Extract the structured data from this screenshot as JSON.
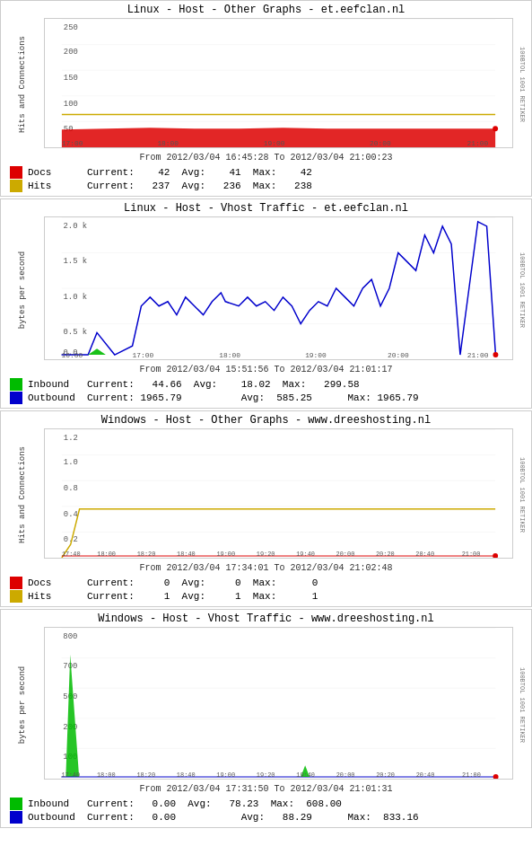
{
  "charts": [
    {
      "id": "linux-host-other",
      "title": "Linux - Host - Other Graphs - et.eefclan.nl",
      "timestamp_from": "From 2012/03/04 16:45:28 To 2012/03/04 21:00:23",
      "y_axis_label": "Hits and Connections",
      "right_label": "100BTOL  1001  RETIKER",
      "x_labels": [
        "17:00",
        "18:00",
        "19:00",
        "20:00",
        "21:00"
      ],
      "y_max": 250,
      "legend": [
        {
          "color": "#dd0000",
          "label": "Docs",
          "current": "42",
          "avg": "41",
          "max": "42"
        },
        {
          "color": "#ccaa00",
          "label": "Hits",
          "current": "237",
          "avg": "236",
          "max": "238"
        }
      ],
      "type": "hits"
    },
    {
      "id": "linux-host-vhost",
      "title": "Linux - Host - Vhost Traffic - et.eefclan.nl",
      "timestamp_from": "From 2012/03/04 15:51:56 To 2012/03/04 21:01:17",
      "y_axis_label": "bytes per second",
      "right_label": "100BTOL  1001  RETIKER",
      "x_labels": [
        "16:00",
        "17:00",
        "18:00",
        "19:00",
        "20:00",
        "21:00"
      ],
      "y_max": 2000,
      "legend": [
        {
          "color": "#00bb00",
          "label": "Inbound",
          "current": "44.66",
          "avg": "18.02",
          "max": "299.58"
        },
        {
          "color": "#0000cc",
          "label": "Outbound",
          "current": "1965.79",
          "avg": "585.25",
          "max": "1965.79"
        }
      ],
      "type": "traffic"
    },
    {
      "id": "windows-host-other",
      "title": "Windows - Host - Other Graphs - www.dreeshosting.nl",
      "timestamp_from": "From 2012/03/04 17:34:01 To 2012/03/04 21:02:48",
      "y_axis_label": "Hits and Connections",
      "right_label": "100BTOL  1001  RETIKER",
      "x_labels": [
        "17:40",
        "18:00",
        "18:20",
        "18:40",
        "19:00",
        "19:20",
        "19:40",
        "20:00",
        "20:20",
        "20:40",
        "21:00"
      ],
      "y_max": 1.4,
      "legend": [
        {
          "color": "#dd0000",
          "label": "Docs",
          "current": "0",
          "avg": "0",
          "max": "0"
        },
        {
          "color": "#ccaa00",
          "label": "Hits",
          "current": "1",
          "avg": "1",
          "max": "1"
        }
      ],
      "type": "hits2"
    },
    {
      "id": "windows-host-vhost",
      "title": "Windows - Host - Vhost Traffic - www.dreeshosting.nl",
      "timestamp_from": "From 2012/03/04 17:31:50 To 2012/03/04 21:01:31",
      "y_axis_label": "bytes per second",
      "right_label": "100BTOL  1001  RETIKER",
      "x_labels": [
        "17:40",
        "18:00",
        "18:20",
        "18:40",
        "19:00",
        "19:20",
        "19:40",
        "20:00",
        "20:20",
        "20:40",
        "21:00"
      ],
      "y_max": 900,
      "legend": [
        {
          "color": "#00bb00",
          "label": "Inbound",
          "current": "0.00",
          "avg": "78.23",
          "max": "608.00"
        },
        {
          "color": "#0000cc",
          "label": "Outbound",
          "current": "0.00",
          "avg": "88.29",
          "max": "833.16"
        }
      ],
      "type": "traffic2"
    }
  ]
}
